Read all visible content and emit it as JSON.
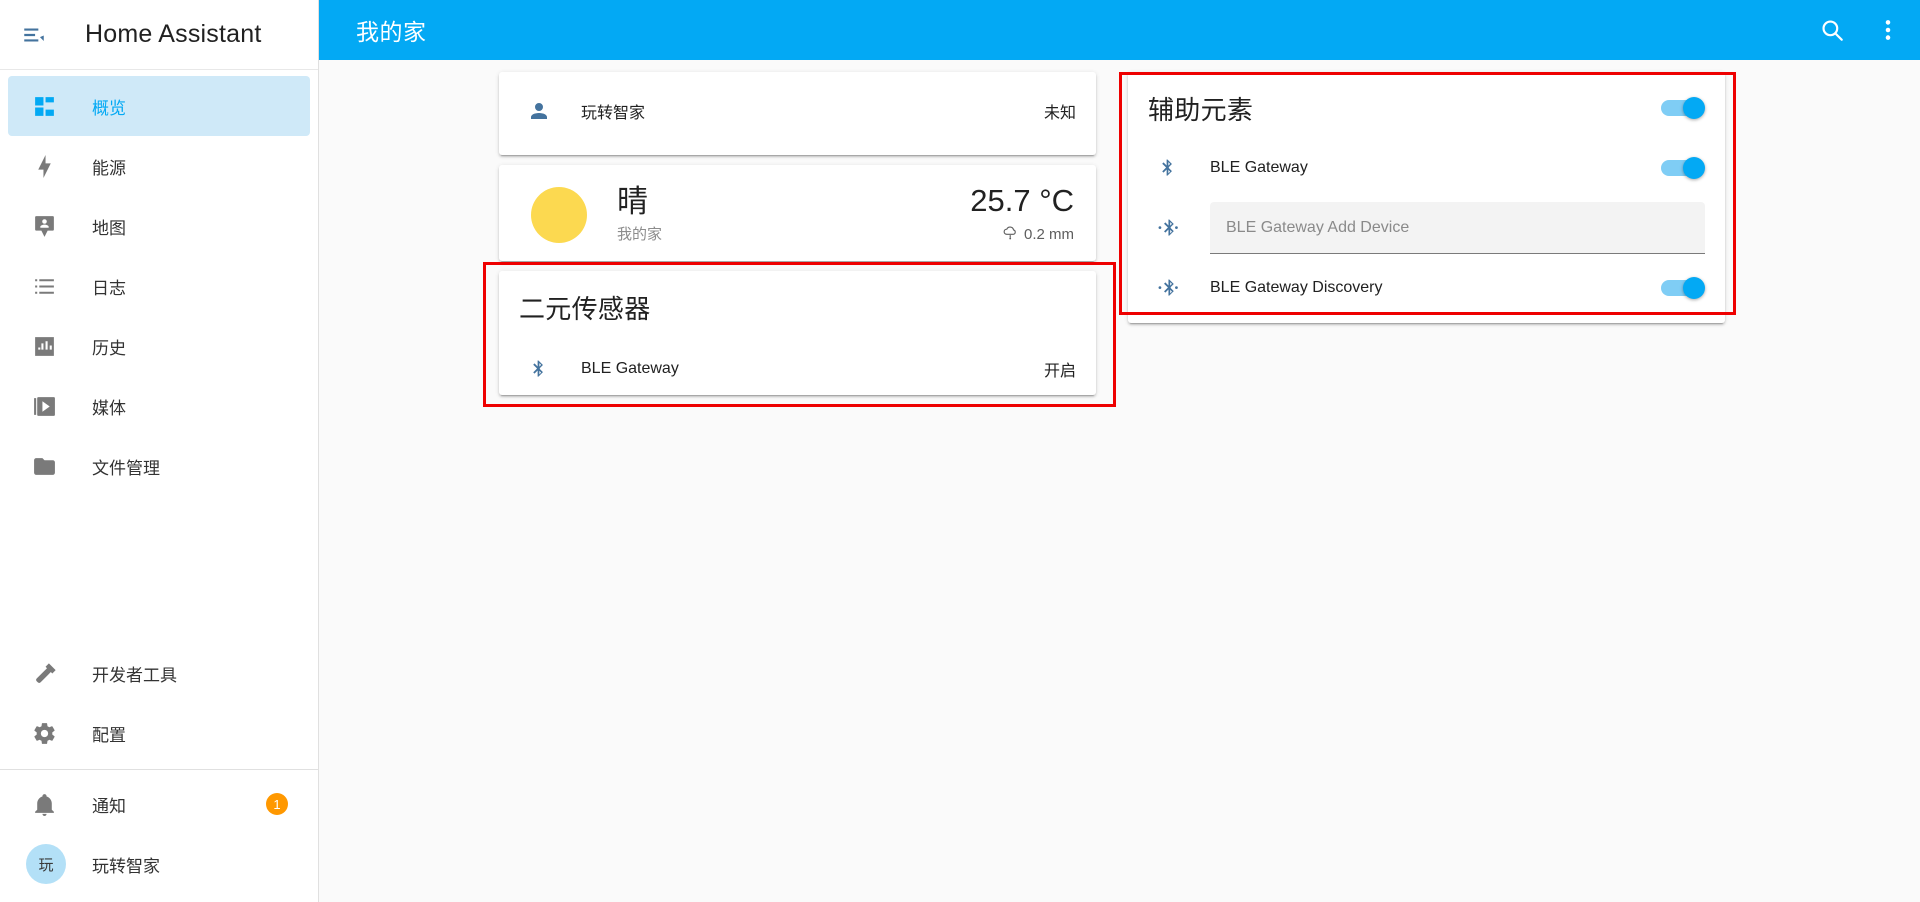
{
  "sidebar": {
    "title": "Home Assistant",
    "menu_icon": "menu-collapse-icon",
    "items": [
      {
        "label": "概览",
        "icon": "view-dashboard-icon",
        "active": true
      },
      {
        "label": "能源",
        "icon": "lightning-bolt-icon",
        "active": false
      },
      {
        "label": "地图",
        "icon": "map-marker-account-icon",
        "active": false
      },
      {
        "label": "日志",
        "icon": "format-list-bulleted-icon",
        "active": false
      },
      {
        "label": "历史",
        "icon": "chart-box-icon",
        "active": false
      },
      {
        "label": "媒体",
        "icon": "play-box-multiple-icon",
        "active": false
      },
      {
        "label": "文件管理",
        "icon": "folder-icon",
        "active": false
      }
    ],
    "bottom_items": [
      {
        "label": "开发者工具",
        "icon": "hammer-wrench-icon"
      },
      {
        "label": "配置",
        "icon": "cog-icon"
      }
    ],
    "notifications": {
      "label": "通知",
      "icon": "bell-icon",
      "badge": "1"
    },
    "user": {
      "label": "玩转智家",
      "avatar_initials": "玩"
    }
  },
  "topbar": {
    "title": "我的家",
    "search_icon": "magnify-icon",
    "overflow_icon": "dots-vertical-icon"
  },
  "cards": {
    "person": {
      "rows": [
        {
          "icon": "account-icon",
          "name": "玩转智家",
          "state": "未知"
        }
      ]
    },
    "weather": {
      "condition": "晴",
      "location": "我的家",
      "temperature": "25.7 °C",
      "precipitation": "0.2 mm",
      "precip_icon": "weather-pouring-icon",
      "sun_icon": "weather-sunny-icon"
    },
    "binary_sensor": {
      "title": "二元传感器",
      "highlighted": true,
      "rows": [
        {
          "icon": "bluetooth-icon",
          "name": "BLE Gateway",
          "state": "开启"
        }
      ]
    },
    "helpers": {
      "title": "辅助元素",
      "highlighted": true,
      "header_toggle": {
        "name": "helpers-master-toggle",
        "state": "on"
      },
      "rows": [
        {
          "type": "toggle",
          "icon": "bluetooth-icon",
          "name": "BLE Gateway",
          "state": "on"
        },
        {
          "type": "text",
          "icon": "bluetooth-transfer-icon",
          "name": "BLE Gateway Add Device",
          "value": "",
          "placeholder": "BLE Gateway Add Device"
        },
        {
          "type": "toggle",
          "icon": "bluetooth-transfer-icon",
          "name": "BLE Gateway Discovery",
          "state": "on"
        }
      ]
    }
  },
  "colors": {
    "accent": "#03a9f4",
    "highlight_border": "#ee0000",
    "badge": "#ff9800",
    "sun": "#fcd950",
    "icon_blue": "#44739e"
  }
}
